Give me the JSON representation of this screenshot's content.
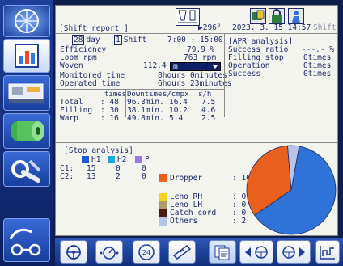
{
  "header": {
    "title": "Shift report",
    "angle": "296°",
    "datetime": "2023. 3. 15 14:57",
    "shift_label": "Shift"
  },
  "period": {
    "days": "28",
    "day_label": "day",
    "shift_number": "1",
    "shift_label": "Shift",
    "time_range": "7:00 - 15:00"
  },
  "stats": {
    "efficiency_label": "Efficiency",
    "efficiency_value": "79.9 %",
    "speed_label": "Loom rpm",
    "speed_value": "763 rpm",
    "woven_label": "Woven",
    "woven_value": "112.4",
    "woven_unit": "m",
    "monitored_label": "Monitored time",
    "monitored_value": "8hours  0minutes",
    "operated_label": "Operated time",
    "operated_value": "6hours 23minutes"
  },
  "apr": {
    "title": "[APR analysis]",
    "rows": [
      {
        "label": "Success ratio",
        "value": "---.- %"
      },
      {
        "label": "Filling stop",
        "value": "0times"
      },
      {
        "label": "Operation",
        "value": "0times"
      },
      {
        "label": "Success",
        "value": "0times"
      }
    ]
  },
  "stops_table": {
    "headers": [
      "times",
      "Downtime",
      "s/cmpx",
      "s/h"
    ],
    "rows": [
      {
        "label": "Total",
        "times": "48",
        "downtime": "96.3min.",
        "scmpx": "16.4",
        "sh": "7.5"
      },
      {
        "label": "Filling",
        "times": "30",
        "downtime": "38.1min.",
        "scmpx": "10.2",
        "sh": "4.6"
      },
      {
        "label": "Warp",
        "times": "16",
        "downtime": "49.8min.",
        "scmpx": "5.4",
        "sh": "2.5"
      }
    ]
  },
  "stop_analysis": {
    "title": "[Stop analysis]",
    "legend": [
      {
        "label": "H1",
        "color": "#1e5bd6"
      },
      {
        "label": "H2",
        "color": "#19a8e0"
      },
      {
        "label": "P",
        "color": "#9a7be0"
      }
    ],
    "channels": [
      {
        "label": "C1:",
        "h1": "15",
        "h2": "0",
        "p": "0"
      },
      {
        "label": "C2:",
        "h1": "13",
        "h2": "2",
        "p": "0"
      }
    ],
    "causes": [
      {
        "label": "Dropper",
        "value": "16",
        "color": "#e8601c"
      },
      {
        "label": "Leno RH",
        "value": "0",
        "color": "#f2d21c"
      },
      {
        "label": "Leno LH",
        "value": "0",
        "color": "#b09a6a"
      },
      {
        "label": "Catch cord",
        "value": "0",
        "color": "#4a1c10"
      },
      {
        "label": "Others",
        "value": "2",
        "color": "#b9c4ea"
      }
    ]
  },
  "chart_data": {
    "type": "pie",
    "slices": [
      {
        "label": "Filling",
        "value": 30,
        "color": "#2f72d8"
      },
      {
        "label": "Dropper",
        "value": 16,
        "color": "#e8601c"
      },
      {
        "label": "Others",
        "value": 2,
        "color": "#b9c4ea"
      }
    ]
  }
}
